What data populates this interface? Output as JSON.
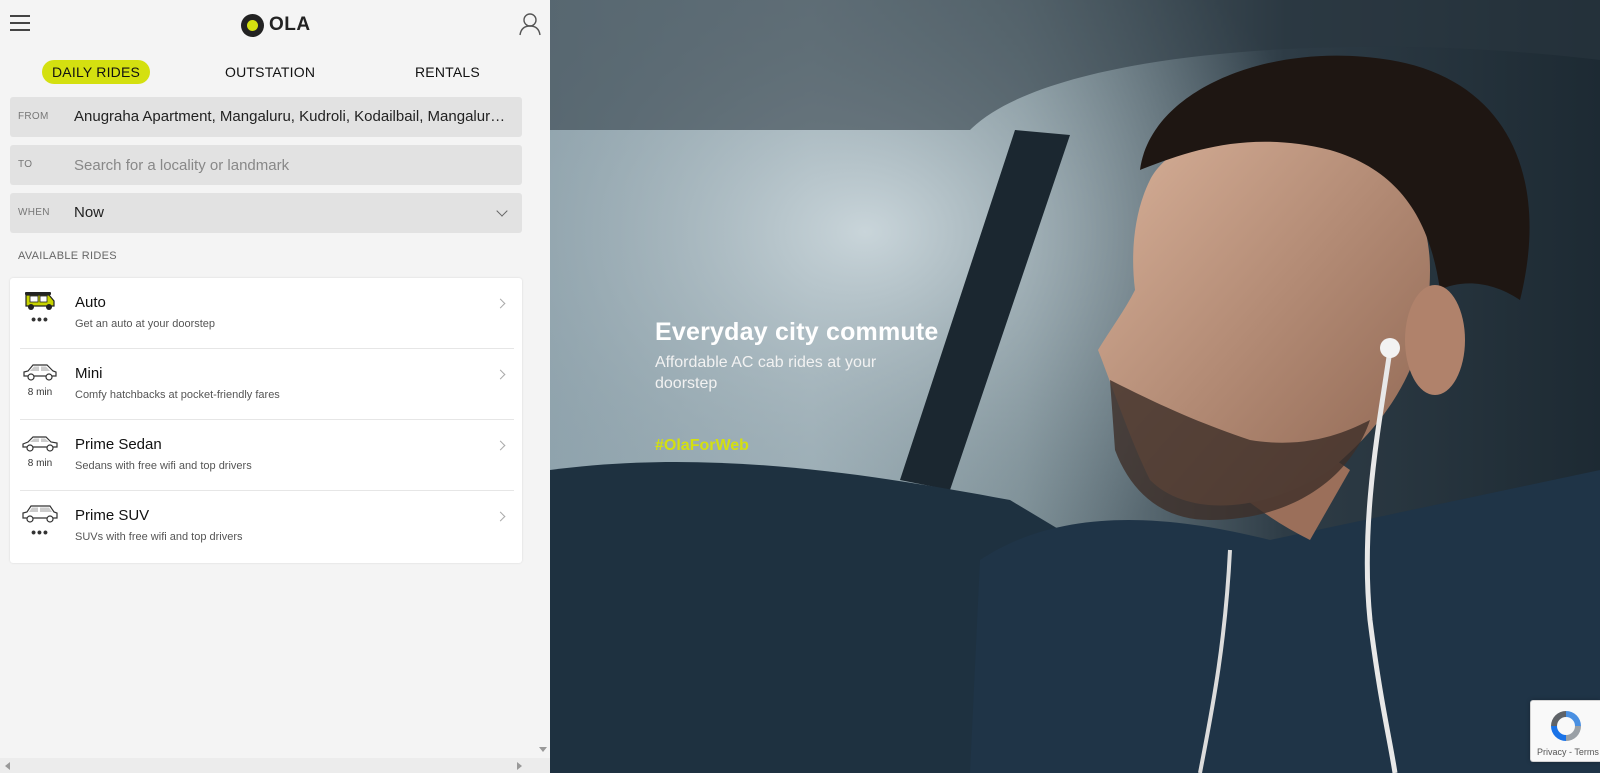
{
  "brand": {
    "logo_text": "OLA",
    "accent": "#d4e010"
  },
  "tabs": [
    {
      "label": "DAILY RIDES",
      "active": true
    },
    {
      "label": "OUTSTATION",
      "active": false
    },
    {
      "label": "RENTALS",
      "active": false
    }
  ],
  "form": {
    "from": {
      "label": "FROM",
      "value": "Anugraha Apartment, Mangaluru, Kudroli, Kodailbail, Mangaluru, Karnataka"
    },
    "to": {
      "label": "TO",
      "placeholder": "Search for a locality or landmark"
    },
    "when": {
      "label": "WHEN",
      "value": "Now"
    }
  },
  "available_rides_label": "AVAILABLE RIDES",
  "rides": [
    {
      "name": "Auto",
      "description": "Get an auto at your doorstep",
      "eta": "•••",
      "icon": "auto-rickshaw-icon"
    },
    {
      "name": "Mini",
      "description": "Comfy hatchbacks at pocket-friendly fares",
      "eta": "8 min",
      "icon": "hatchback-icon"
    },
    {
      "name": "Prime Sedan",
      "description": "Sedans with free wifi and top drivers",
      "eta": "8 min",
      "icon": "sedan-icon"
    },
    {
      "name": "Prime SUV",
      "description": "SUVs with free wifi and top drivers",
      "eta": "•••",
      "icon": "suv-icon"
    }
  ],
  "hero": {
    "title": "Everyday city commute",
    "subtitle": "Affordable AC cab rides at your doorstep",
    "hashtag": "#OlaForWeb"
  },
  "recaptcha": {
    "terms": "Privacy - Terms"
  }
}
